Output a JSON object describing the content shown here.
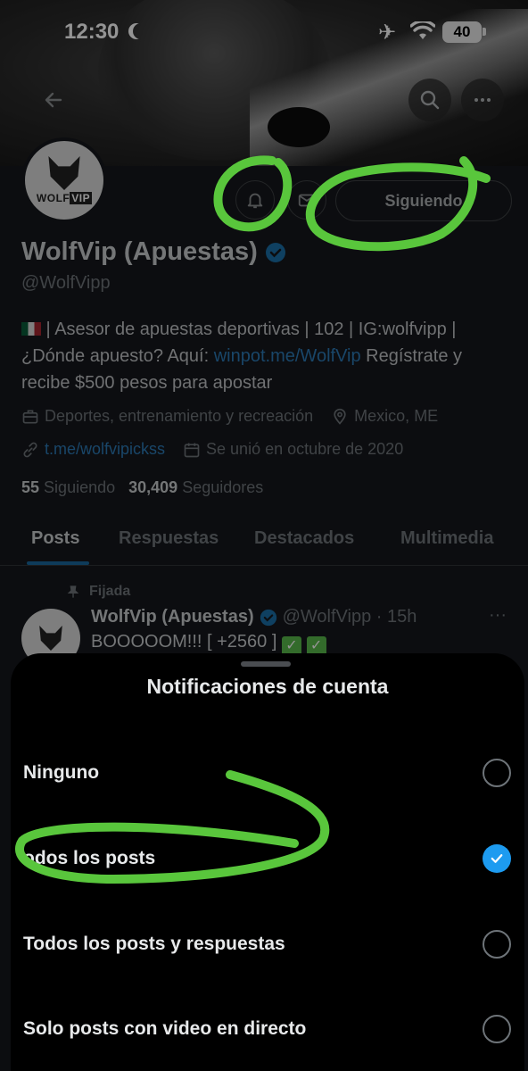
{
  "status_bar": {
    "time": "12:30",
    "battery": "40"
  },
  "profile": {
    "display_name": "WolfVip (Apuestas)",
    "handle": "@WolfVipp",
    "avatar_brand_a": "WOLF",
    "avatar_brand_b": "VIP",
    "following_button": "Siguiendo",
    "bio_part1": " | Asesor de apuestas deportivas | 102 | IG:wolfvipp | ¿Dónde apuesto? Aquí: ",
    "bio_link": "winpot.me/WolfVip",
    "bio_part2": " Regístrate y recibe $500 pesos para apostar",
    "category": "Deportes, entrenamiento y recreación",
    "location": "Mexico, ME",
    "website": "t.me/wolfvipickss",
    "joined": "Se unió en octubre de 2020",
    "following_count": "55",
    "following_label": "Siguiendo",
    "followers_count": "30,409",
    "followers_label": "Seguidores"
  },
  "tabs": [
    "Posts",
    "Respuestas",
    "Destacados",
    "Multimedia"
  ],
  "pinned_post": {
    "pinned_label": "Fijada",
    "author": "WolfVip (Apuestas)",
    "handle_time": "@WolfVipp · 15h",
    "text": "BOOOOOM!!! [ +2560 ]"
  },
  "sheet": {
    "title": "Notificaciones de cuenta",
    "options": [
      {
        "label": "Ninguno",
        "selected": false
      },
      {
        "label": "odos los posts",
        "selected": true
      },
      {
        "label": "Todos los posts y respuestas",
        "selected": false
      },
      {
        "label": "Solo posts con video en directo",
        "selected": false
      }
    ]
  },
  "colors": {
    "accent": "#1d9bf0",
    "annotation": "#59c63c"
  },
  "icons": [
    "back-arrow-icon",
    "search-icon",
    "more-icon",
    "bell-icon",
    "mail-icon",
    "verified-icon",
    "briefcase-icon",
    "location-icon",
    "link-icon",
    "calendar-icon",
    "pin-icon",
    "checkmark-icon"
  ]
}
